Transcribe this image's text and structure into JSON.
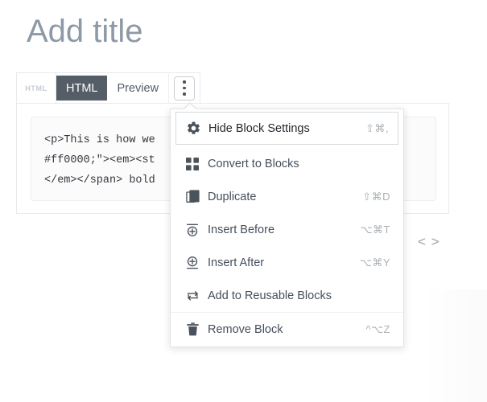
{
  "editor": {
    "title_placeholder": "Add title",
    "code_content": "<p>This is how we\n#ff0000;\"><em><st\n</em></span> bold",
    "inline_code_icon": "< >"
  },
  "toolbar": {
    "block_icon_label": "HTML",
    "tabs": [
      {
        "label": "HTML",
        "active": true
      },
      {
        "label": "Preview",
        "active": false
      }
    ],
    "more_button_name": "more-options"
  },
  "dropdown": {
    "groups": [
      {
        "items": [
          {
            "label": "Hide Block Settings",
            "shortcut": "⇧⌘,",
            "icon": "gear-icon",
            "focused": true
          },
          {
            "label": "Convert to Blocks",
            "shortcut": "",
            "icon": "grid-icon",
            "focused": false
          },
          {
            "label": "Duplicate",
            "shortcut": "⇧⌘D",
            "icon": "duplicate-icon",
            "focused": false
          },
          {
            "label": "Insert Before",
            "shortcut": "⌥⌘T",
            "icon": "insert-before-icon",
            "focused": false
          },
          {
            "label": "Insert After",
            "shortcut": "⌥⌘Y",
            "icon": "insert-after-icon",
            "focused": false
          },
          {
            "label": "Add to Reusable Blocks",
            "shortcut": "",
            "icon": "reusable-icon",
            "focused": false
          }
        ]
      },
      {
        "items": [
          {
            "label": "Remove Block",
            "shortcut": "^⌥Z",
            "icon": "trash-icon",
            "focused": false
          }
        ]
      }
    ]
  },
  "colors": {
    "accent_dark": "#555d66",
    "text": "#454f5b",
    "muted": "#aab0b7",
    "title_placeholder": "#8d99a6",
    "border": "#e2e4e7"
  }
}
